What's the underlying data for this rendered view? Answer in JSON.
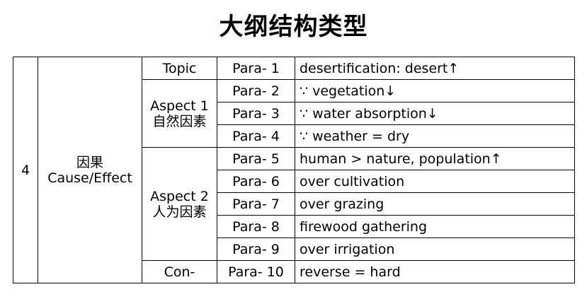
{
  "title": "大纲结构类型",
  "table": {
    "number": "4",
    "category": {
      "zh": "因果",
      "en": "Cause/Effect"
    },
    "sections": {
      "topic": "Topic",
      "aspect1": {
        "label": "Aspect 1",
        "zh": "自然因素"
      },
      "aspect2": {
        "label": "Aspect 2",
        "zh": "人为因素"
      },
      "con": "Con-"
    },
    "rows": [
      {
        "para": "Para- 1",
        "content": "desertification: desert↑"
      },
      {
        "para": "Para- 2",
        "content": "∵ vegetation↓"
      },
      {
        "para": "Para- 3",
        "content": "∵ water absorption↓"
      },
      {
        "para": "Para- 4",
        "content": "∵ weather = dry"
      },
      {
        "para": "Para- 5",
        "content": "human > nature, population↑"
      },
      {
        "para": "Para- 6",
        "content": "over cultivation"
      },
      {
        "para": "Para- 7",
        "content": "over grazing"
      },
      {
        "para": "Para- 8",
        "content": "firewood gathering"
      },
      {
        "para": "Para- 9",
        "content": "over irrigation"
      },
      {
        "para": "Para- 10",
        "content": "reverse = hard"
      }
    ]
  }
}
